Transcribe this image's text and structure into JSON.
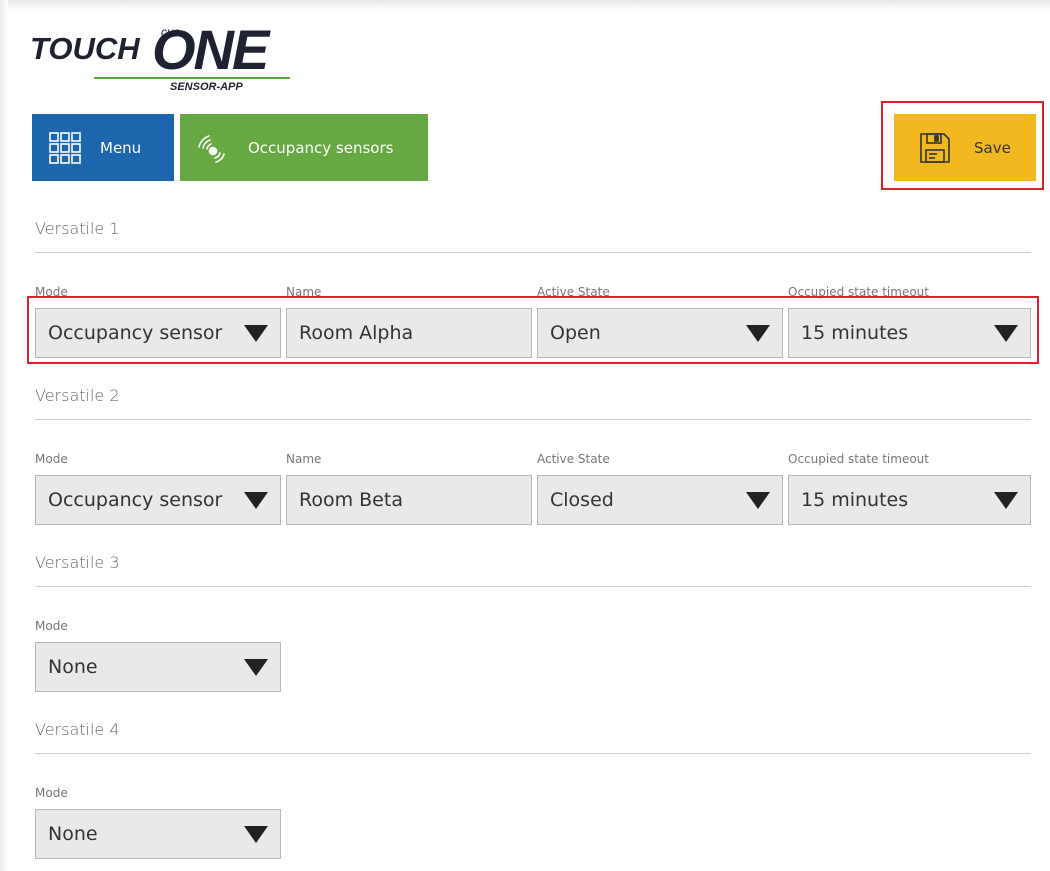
{
  "logo": {
    "touch": "TOUCH",
    "cue": "cue",
    "one": "ONE",
    "sub": "SENSOR-APP"
  },
  "toolbar": {
    "menu_label": "Menu",
    "occupancy_label": "Occupancy sensors",
    "save_label": "Save",
    "menu_icon": "grid-icon",
    "occupancy_icon": "sensor-waves-icon",
    "save_icon": "floppy-disk-icon"
  },
  "colors": {
    "menu": "#1d65ac",
    "occupancy": "#66a841",
    "save": "#f2b81f",
    "highlight": "#e0202a"
  },
  "versatiles": [
    {
      "title": "Versatile 1",
      "mode_label": "Mode",
      "mode": "Occupancy sensor",
      "name_label": "Name",
      "name": "Room Alpha",
      "active_label": "Active State",
      "active": "Open",
      "timeout_label": "Occupied state timeout",
      "timeout": "15 minutes"
    },
    {
      "title": "Versatile 2",
      "mode_label": "Mode",
      "mode": "Occupancy sensor",
      "name_label": "Name",
      "name": "Room Beta",
      "active_label": "Active State",
      "active": "Closed",
      "timeout_label": "Occupied state timeout",
      "timeout": "15 minutes"
    },
    {
      "title": "Versatile 3",
      "mode_label": "Mode",
      "mode": "None"
    },
    {
      "title": "Versatile 4",
      "mode_label": "Mode",
      "mode": "None"
    }
  ]
}
